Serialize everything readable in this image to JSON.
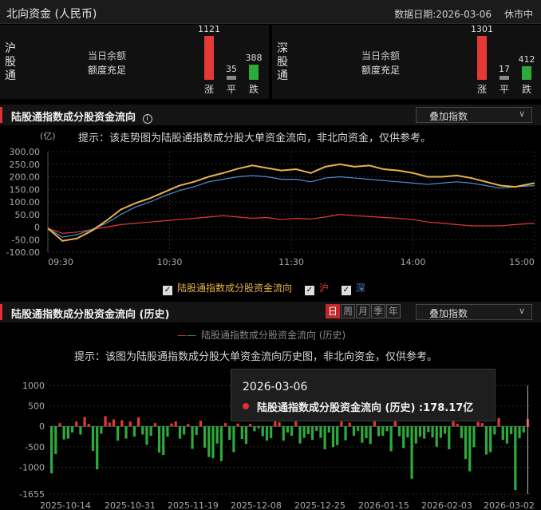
{
  "header": {
    "title": "北向资金 (人民币)",
    "date_label": "数据日期:2026-03-06",
    "status": "休市中"
  },
  "markets": [
    {
      "name_chars": [
        "沪",
        "股",
        "通"
      ],
      "quota_label": "当日余额",
      "quota_value": "额度充足",
      "bars": [
        {
          "label": "涨",
          "count": "1121",
          "value": 1121,
          "color": "#e53935"
        },
        {
          "label": "平",
          "count": "35",
          "value": 35,
          "color": "#888888"
        },
        {
          "label": "跌",
          "count": "388",
          "value": 388,
          "color": "#2eaa3c"
        }
      ]
    },
    {
      "name_chars": [
        "深",
        "股",
        "通"
      ],
      "quota_label": "当日余额",
      "quota_value": "额度充足",
      "bars": [
        {
          "label": "涨",
          "count": "1301",
          "value": 1301,
          "color": "#e53935"
        },
        {
          "label": "平",
          "count": "17",
          "value": 17,
          "color": "#888888"
        },
        {
          "label": "跌",
          "count": "412",
          "value": 412,
          "color": "#2eaa3c"
        }
      ]
    }
  ],
  "intraday": {
    "title": "陆股通指数成分股资金流向",
    "info_icon": "info-icon",
    "overlay_label": "叠加指数",
    "unit": "(亿)",
    "hint": "提示：该走势图为陆股通指数成分股大单资金流向，非北向资金，仅供参考。",
    "legend": [
      {
        "label": "陆股通指数成分股资金流向",
        "color": "#e8b24a",
        "checked": true
      },
      {
        "label": "沪",
        "color": "#e53935",
        "checked": true
      },
      {
        "label": "深",
        "color": "#4d8fd6",
        "checked": true
      }
    ]
  },
  "history": {
    "title": "陆股通指数成分股资金流向 (历史)",
    "tabs": [
      {
        "label": "日",
        "active": true
      },
      {
        "label": "周",
        "active": false
      },
      {
        "label": "月",
        "active": false
      },
      {
        "label": "季",
        "active": false
      },
      {
        "label": "年",
        "active": false
      }
    ],
    "overlay_label": "叠加指数",
    "legend_label": "陆股通指数成分股资金流向 (历史)",
    "hint": "提示：该图为陆股通指数成分股大单资金流向历史图，非北向资金，仅供参考。",
    "tooltip": {
      "date": "2026-03-06",
      "series_label": "陆股通指数成分股资金流向 (历史) :178.17亿"
    }
  },
  "chart_data": [
    {
      "type": "line",
      "ylim": [
        -100,
        300
      ],
      "yticks": [
        "300.00",
        "250.00",
        "200.00",
        "150.00",
        "100.00",
        "50.00",
        "0",
        "-50.00",
        "-100.00"
      ],
      "ytick_values": [
        300,
        250,
        200,
        150,
        100,
        50,
        0,
        -50,
        -100
      ],
      "xticks": [
        "09:30",
        "10:30",
        "11:30",
        "14:00",
        "15:00"
      ],
      "x": [
        0,
        0.03,
        0.06,
        0.09,
        0.12,
        0.15,
        0.18,
        0.21,
        0.24,
        0.27,
        0.3,
        0.33,
        0.36,
        0.39,
        0.42,
        0.45,
        0.48,
        0.51,
        0.54,
        0.57,
        0.6,
        0.63,
        0.66,
        0.69,
        0.72,
        0.75,
        0.78,
        0.81,
        0.84,
        0.87,
        0.9,
        0.93,
        0.96,
        1.0
      ],
      "series": [
        {
          "name": "陆股通指数成分股资金流向",
          "color": "#e8b24a",
          "values": [
            -5,
            -55,
            -45,
            -15,
            25,
            70,
            95,
            115,
            140,
            165,
            180,
            200,
            215,
            232,
            245,
            235,
            225,
            230,
            215,
            240,
            250,
            240,
            245,
            230,
            225,
            215,
            200,
            200,
            205,
            195,
            180,
            165,
            160,
            175
          ]
        },
        {
          "name": "深",
          "color": "#4d8fd6",
          "values": [
            -5,
            -40,
            -30,
            -10,
            15,
            50,
            80,
            100,
            125,
            145,
            160,
            180,
            190,
            200,
            205,
            200,
            190,
            190,
            180,
            195,
            200,
            195,
            190,
            185,
            180,
            175,
            170,
            175,
            180,
            175,
            165,
            155,
            160,
            165
          ]
        },
        {
          "name": "沪",
          "color": "#e53935",
          "values": [
            -5,
            -25,
            -20,
            -10,
            0,
            10,
            15,
            20,
            25,
            30,
            35,
            40,
            45,
            40,
            35,
            38,
            30,
            35,
            32,
            40,
            50,
            45,
            42,
            38,
            35,
            30,
            20,
            15,
            10,
            5,
            5,
            5,
            10,
            15
          ]
        }
      ]
    },
    {
      "type": "bar",
      "yticks": [
        "1000",
        "500",
        "0",
        "-500",
        "-1000",
        "-1655"
      ],
      "ytick_values": [
        1000,
        500,
        0,
        -500,
        -1000,
        -1655
      ],
      "ylim": [
        -1655,
        1000
      ],
      "xticks": [
        "2025-10-14",
        "2025-10-31",
        "2025-11-19",
        "2025-12-08",
        "2025-12-25",
        "2026-01-15",
        "2026-02-03",
        "2026-03-02"
      ],
      "values": [
        -1150,
        -680,
        80,
        -320,
        -300,
        -150,
        120,
        -200,
        230,
        60,
        -600,
        -1050,
        -180,
        250,
        90,
        170,
        -350,
        150,
        -300,
        120,
        -250,
        220,
        -200,
        -450,
        -230,
        80,
        -640,
        -700,
        -250,
        70,
        120,
        -300,
        -200,
        60,
        -550,
        -210,
        140,
        -520,
        -750,
        -780,
        -420,
        -850,
        80,
        -330,
        -630,
        70,
        -310,
        -430,
        60,
        -120,
        -50,
        -240,
        -350,
        -290,
        270,
        100,
        -350,
        -150,
        -230,
        260,
        -420,
        -280,
        -190,
        -330,
        -110,
        -280,
        -560,
        -150,
        -510,
        -460,
        150,
        -340,
        90,
        -230,
        -110,
        -400,
        -290,
        -430,
        250,
        -240,
        -230,
        -120,
        -610,
        140,
        -240,
        -530,
        -270,
        -1280,
        -420,
        -250,
        -300,
        -140,
        -270,
        -500,
        -280,
        -180,
        -560,
        120,
        60,
        -290,
        -800,
        -1100,
        -510,
        110,
        80,
        -690,
        -630,
        -200,
        200,
        -330,
        -420,
        -190,
        -1560,
        -290,
        -150,
        178
      ]
    }
  ]
}
